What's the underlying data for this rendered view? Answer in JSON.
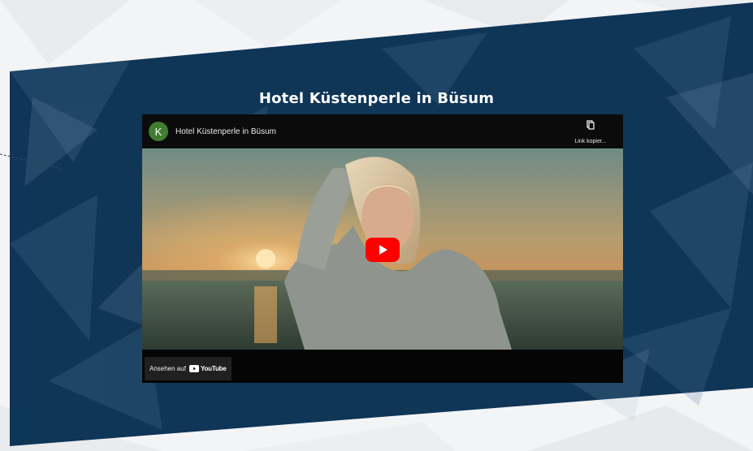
{
  "section": {
    "title": "Hotel Küstenperle in Büsum"
  },
  "video": {
    "channel_initial": "K",
    "title": "Hotel Küstenperle in Büsum",
    "copy_link_label": "Link kopier...",
    "watch_on_label": "Ansehen auf",
    "platform_label": "YouTube"
  },
  "colors": {
    "band": "#0f3557",
    "avatar": "#3f7d31",
    "play_button": "#ff0000"
  },
  "icons": {
    "play": "play-icon",
    "copy": "copy-icon",
    "youtube": "youtube-logo-icon"
  }
}
